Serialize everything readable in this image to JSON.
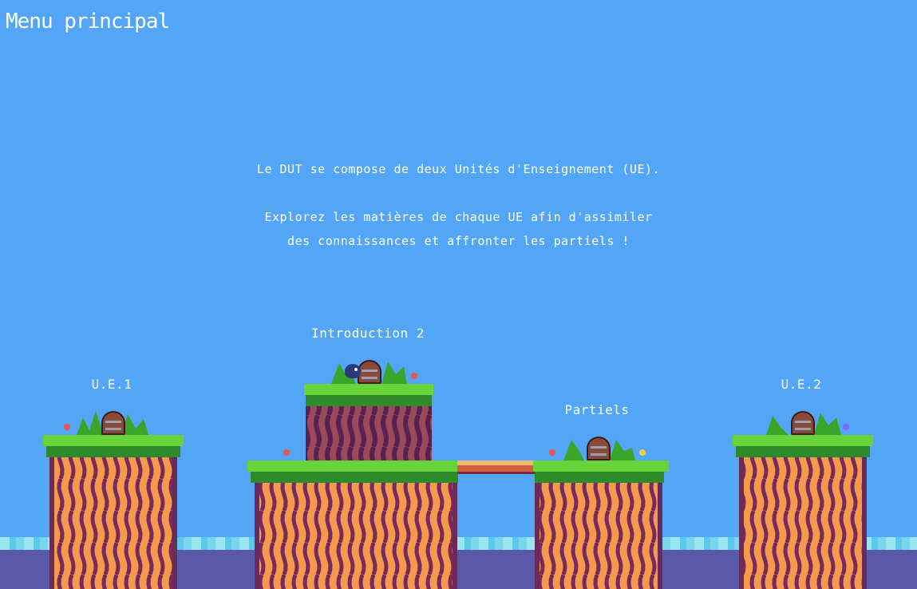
{
  "header": {
    "title": "Menu principal"
  },
  "intro": {
    "line1": "Le DUT se compose de deux Unités d'Enseignement (UE).",
    "line2": "Explorez les matières de chaque UE afin d'assimiler",
    "line3": "des connaissances et affronter les partiels !"
  },
  "levels": {
    "ue1": "U.E.1",
    "intro2": "Introduction 2",
    "partiels": "Partiels",
    "ue2": "U.E.2"
  },
  "colors": {
    "sky": "#53a6f7",
    "grass": "#58c22c",
    "trunk_orange": "#f59a4c",
    "trunk_purple": "#7a3a6a",
    "water": "#5a58a8"
  }
}
